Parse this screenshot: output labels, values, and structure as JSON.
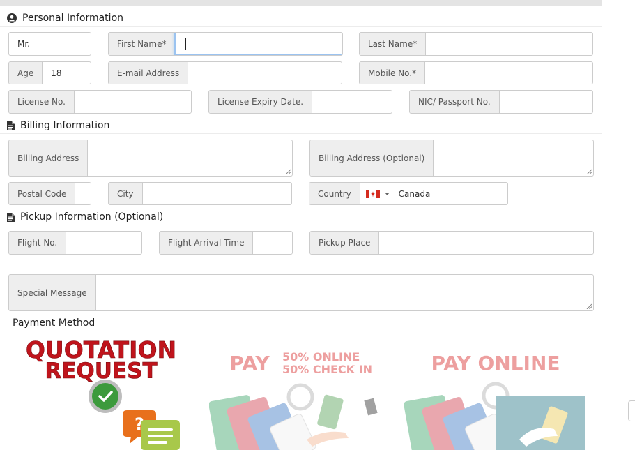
{
  "personal": {
    "heading": "Personal Information",
    "title_value": "Mr.",
    "first_name_label": "First Name*",
    "last_name_label": "Last Name*",
    "age_label": "Age",
    "age_value": "18",
    "email_label": "E-mail Address",
    "mobile_label": "Mobile No.*",
    "license_label": "License No.",
    "license_expiry_label": "License Expiry Date.",
    "nic_label": "NIC/ Passport No."
  },
  "billing": {
    "heading": "Billing Information",
    "address_label": "Billing Address",
    "address2_label": "Billing Address (Optional)",
    "postal_label": "Postal Code",
    "city_label": "City",
    "country_label": "Country",
    "country_value": "Canada"
  },
  "pickup": {
    "heading": "Pickup Information (Optional)",
    "flight_label": "Flight No.",
    "arrival_label": "Flight Arrival Time",
    "place_label": "Pickup Place",
    "message_label": "Special Message"
  },
  "payment": {
    "heading": "Payment Method",
    "quotation_line1": "QUOTATION",
    "quotation_line2": "REQUEST",
    "split_pay": "PAY",
    "split_line1": "50% ONLINE",
    "split_line2": "50% CHECK IN",
    "online_label": "PAY ONLINE"
  },
  "colors": {
    "quotation_red": "#c0141c",
    "faded_red": "#e8a0a0",
    "selected_green": "#3c9a3c"
  }
}
